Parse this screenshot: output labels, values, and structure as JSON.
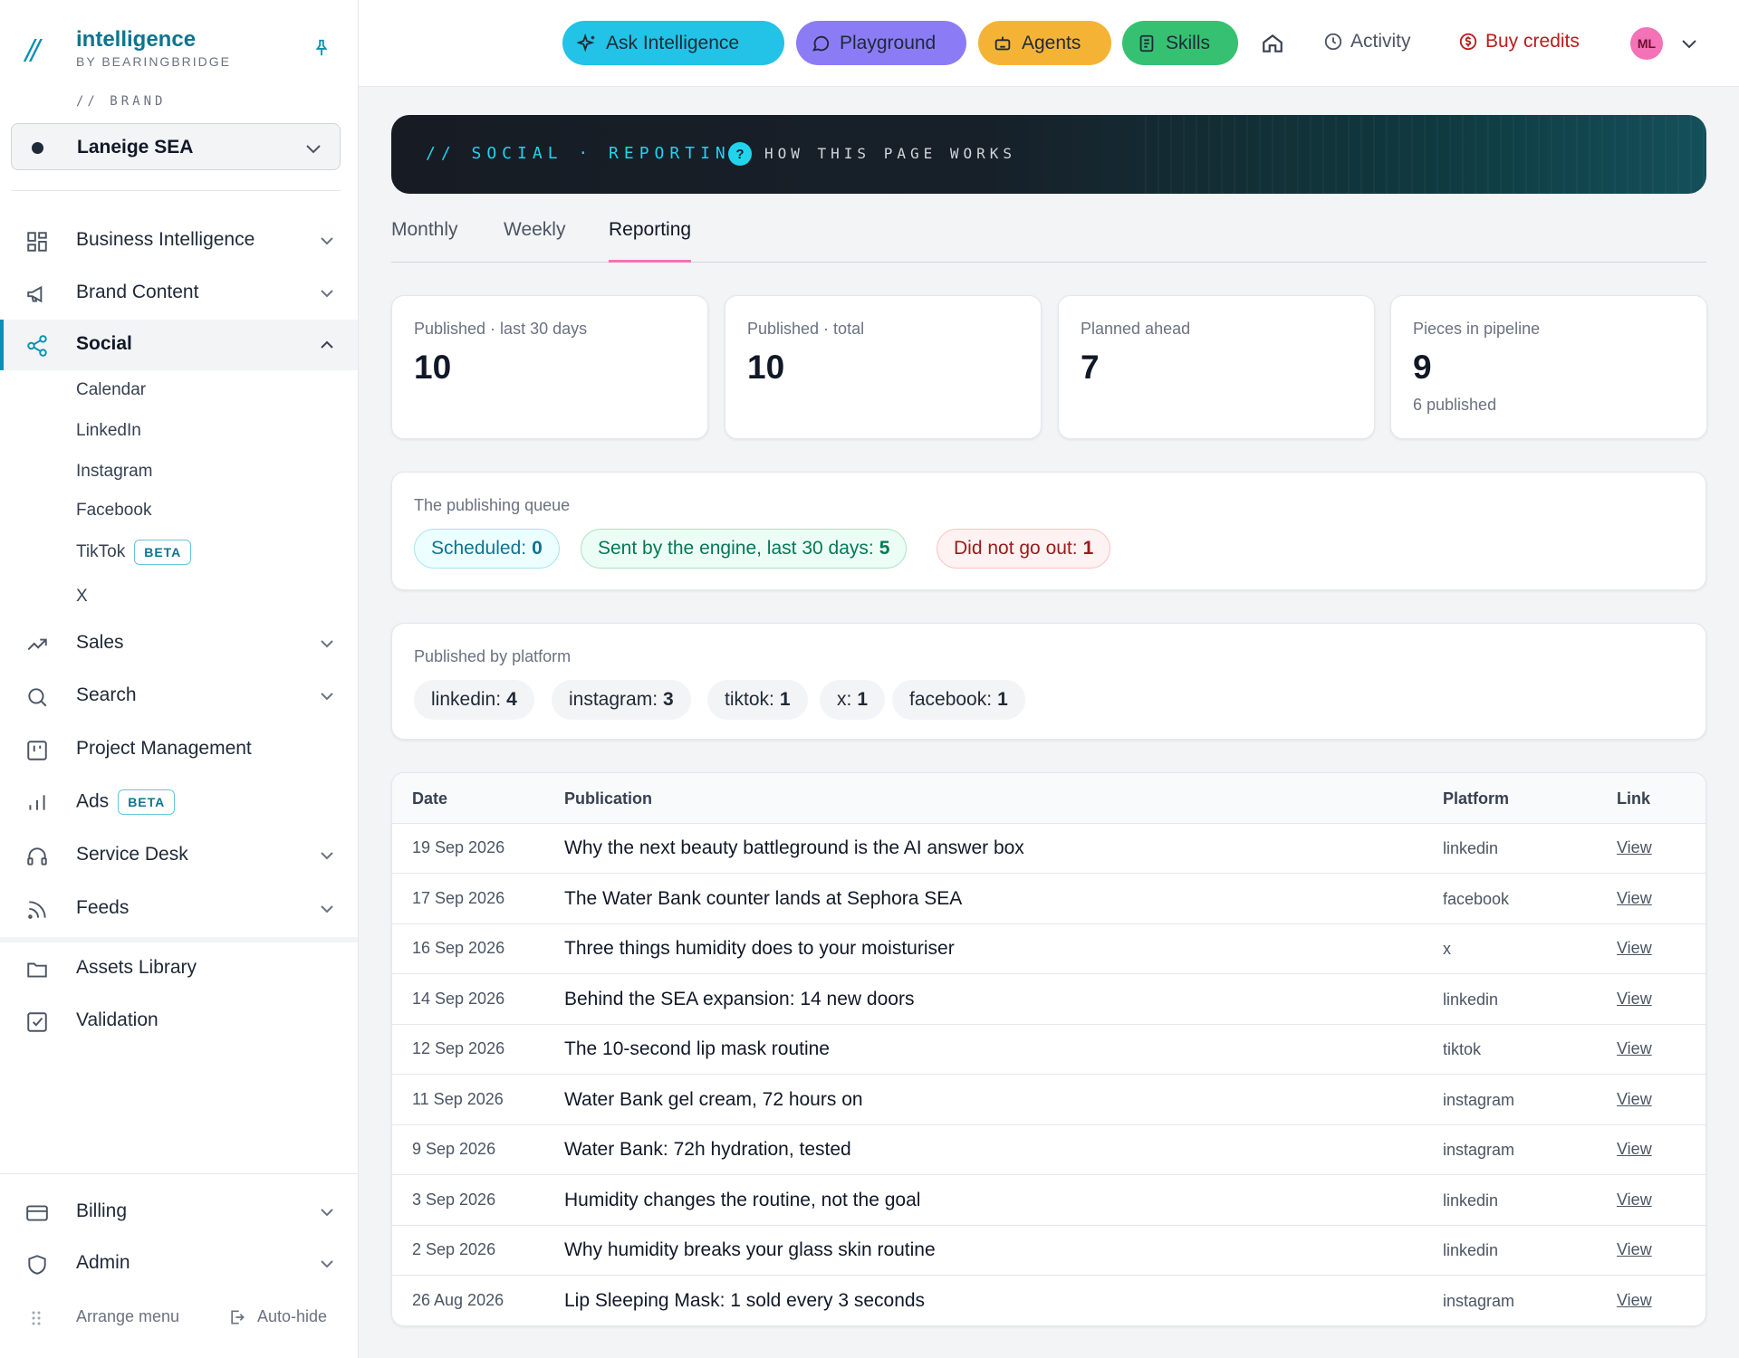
{
  "sidebar": {
    "logo_mark": "//",
    "logo_name": "intelligence",
    "logo_sub": "BY BEARINGBRIDGE",
    "brand_caption": "// BRAND",
    "brand_value": "Laneige SEA",
    "nav": [
      {
        "label": "Business Intelligence",
        "icon": "grid-icon"
      },
      {
        "label": "Brand Content",
        "icon": "megaphone-icon"
      },
      {
        "label": "Social",
        "icon": "share-icon"
      },
      {
        "label": "Sales",
        "icon": "trend-icon"
      },
      {
        "label": "Search",
        "icon": "search-icon"
      },
      {
        "label": "Project Management",
        "icon": "kanban-icon"
      },
      {
        "label": "Ads",
        "icon": "bar-chart-icon",
        "badge": "BETA"
      },
      {
        "label": "Service Desk",
        "icon": "headset-icon"
      },
      {
        "label": "Feeds",
        "icon": "rss-icon"
      },
      {
        "label": "Assets Library",
        "icon": "folder-icon"
      },
      {
        "label": "Validation",
        "icon": "checkbox-icon"
      },
      {
        "label": "Billing",
        "icon": "card-icon"
      },
      {
        "label": "Admin",
        "icon": "shield-icon"
      }
    ],
    "social_sub": [
      "Calendar",
      "LinkedIn",
      "Instagram",
      "Facebook",
      "TikTok",
      "X"
    ],
    "tiktok_badge": "BETA",
    "arrange_menu": "Arrange menu",
    "auto_hide": "Auto-hide"
  },
  "topbar": {
    "ask": "Ask Intelligence",
    "playground": "Playground",
    "agents": "Agents",
    "skills": "Skills",
    "activity": "Activity",
    "buy_credits": "Buy credits",
    "avatar": "ML",
    "colors": {
      "ask": "#22c3e6",
      "playground": "#8b7cf6",
      "agents": "#f5b335",
      "skills": "#36c172"
    }
  },
  "banner": {
    "title": "// SOCIAL · REPORTING",
    "help_badge": "?",
    "help_text": "HOW THIS PAGE WORKS"
  },
  "tabs": [
    "Monthly",
    "Weekly",
    "Reporting"
  ],
  "active_tab": "Reporting",
  "stats": [
    {
      "label": "Published · last 30 days",
      "value": "10",
      "sub": ""
    },
    {
      "label": "Published · total",
      "value": "10",
      "sub": ""
    },
    {
      "label": "Planned ahead",
      "value": "7",
      "sub": ""
    },
    {
      "label": "Pieces in pipeline",
      "value": "9",
      "sub": "6 published"
    }
  ],
  "queue": {
    "label": "The publishing queue",
    "scheduled_label": "Scheduled:",
    "scheduled_value": "0",
    "sent_label": "Sent by the engine, last 30 days:",
    "sent_value": "5",
    "failed_label": "Did not go out:",
    "failed_value": "1"
  },
  "platforms": {
    "label": "Published by platform",
    "items": [
      {
        "name": "linkedin:",
        "count": "4"
      },
      {
        "name": "instagram:",
        "count": "3"
      },
      {
        "name": "tiktok:",
        "count": "1"
      },
      {
        "name": "x:",
        "count": "1"
      },
      {
        "name": "facebook:",
        "count": "1"
      }
    ]
  },
  "table": {
    "headers": {
      "date": "Date",
      "publication": "Publication",
      "platform": "Platform",
      "link": "Link"
    },
    "rows": [
      {
        "date": "19 Sep 2026",
        "publication": "Why the next beauty battleground is the AI answer box",
        "platform": "linkedin",
        "link": "View"
      },
      {
        "date": "17 Sep 2026",
        "publication": "The Water Bank counter lands at Sephora SEA",
        "platform": "facebook",
        "link": "View"
      },
      {
        "date": "16 Sep 2026",
        "publication": "Three things humidity does to your moisturiser",
        "platform": "x",
        "link": "View"
      },
      {
        "date": "14 Sep 2026",
        "publication": "Behind the SEA expansion: 14 new doors",
        "platform": "linkedin",
        "link": "View"
      },
      {
        "date": "12 Sep 2026",
        "publication": "The 10-second lip mask routine",
        "platform": "tiktok",
        "link": "View"
      },
      {
        "date": "11 Sep 2026",
        "publication": "Water Bank gel cream, 72 hours on",
        "platform": "instagram",
        "link": "View"
      },
      {
        "date": "9 Sep 2026",
        "publication": "Water Bank: 72h hydration, tested",
        "platform": "instagram",
        "link": "View"
      },
      {
        "date": "3 Sep 2026",
        "publication": "Humidity changes the routine, not the goal",
        "platform": "linkedin",
        "link": "View"
      },
      {
        "date": "2 Sep 2026",
        "publication": "Why humidity breaks your glass skin routine",
        "platform": "linkedin",
        "link": "View"
      },
      {
        "date": "26 Aug 2026",
        "publication": "Lip Sleeping Mask: 1 sold every 3 seconds",
        "platform": "instagram",
        "link": "View"
      }
    ]
  }
}
